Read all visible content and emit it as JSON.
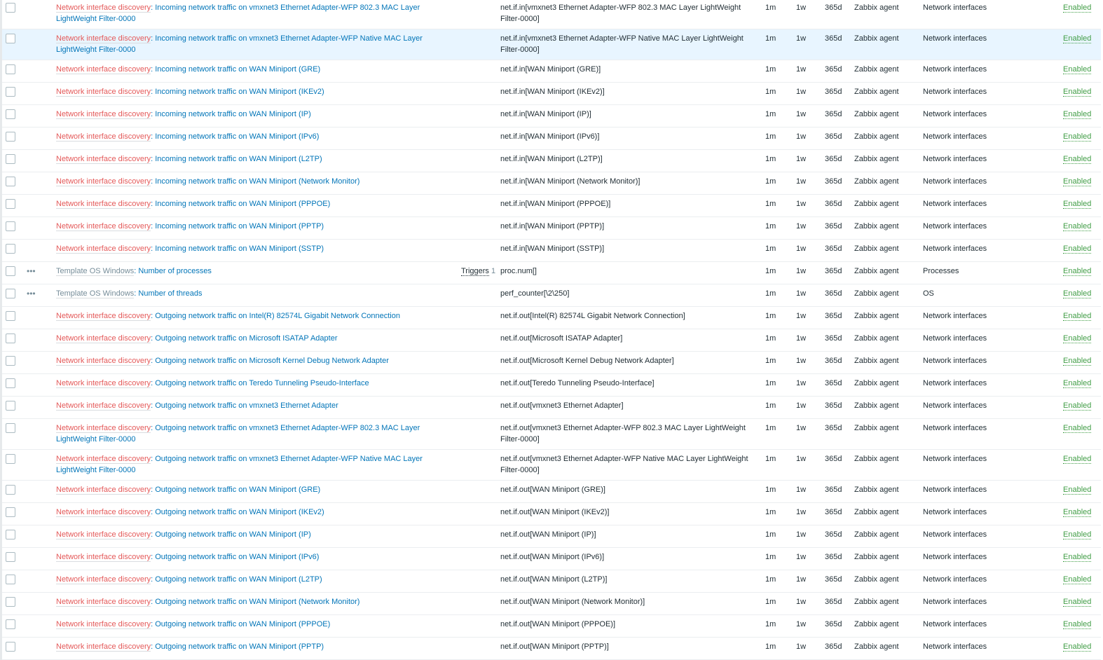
{
  "row_common": {
    "interval": "1m",
    "history": "1w",
    "trends": "365d",
    "type": "Zabbix agent",
    "status": "Enabled",
    "triggers_label": "Triggers"
  },
  "colors": {
    "discovery": "#e45959",
    "link": "#0275b8",
    "enabled": "#429e47",
    "highlight": "#e8f5ff"
  },
  "rows": [
    {
      "prefix": "Network interface discovery",
      "name": "Incoming network traffic on vmxnet3 Ethernet Adapter-WFP 802.3 MAC Layer LightWeight Filter-0000",
      "key": "net.if.in[vmxnet3 Ethernet Adapter-WFP 802.3 MAC Layer LightWeight Filter-0000]",
      "app": "Network interfaces"
    },
    {
      "prefix": "Network interface discovery",
      "name": "Incoming network traffic on vmxnet3 Ethernet Adapter-WFP Native MAC Layer LightWeight Filter-0000",
      "key": "net.if.in[vmxnet3 Ethernet Adapter-WFP Native MAC Layer LightWeight Filter-0000]",
      "app": "Network interfaces",
      "highlight": true
    },
    {
      "prefix": "Network interface discovery",
      "name": "Incoming network traffic on WAN Miniport (GRE)",
      "key": "net.if.in[WAN Miniport (GRE)]",
      "app": "Network interfaces"
    },
    {
      "prefix": "Network interface discovery",
      "name": "Incoming network traffic on WAN Miniport (IKEv2)",
      "key": "net.if.in[WAN Miniport (IKEv2)]",
      "app": "Network interfaces"
    },
    {
      "prefix": "Network interface discovery",
      "name": "Incoming network traffic on WAN Miniport (IP)",
      "key": "net.if.in[WAN Miniport (IP)]",
      "app": "Network interfaces"
    },
    {
      "prefix": "Network interface discovery",
      "name": "Incoming network traffic on WAN Miniport (IPv6)",
      "key": "net.if.in[WAN Miniport (IPv6)]",
      "app": "Network interfaces"
    },
    {
      "prefix": "Network interface discovery",
      "name": "Incoming network traffic on WAN Miniport (L2TP)",
      "key": "net.if.in[WAN Miniport (L2TP)]",
      "app": "Network interfaces"
    },
    {
      "prefix": "Network interface discovery",
      "name": "Incoming network traffic on WAN Miniport (Network Monitor)",
      "key": "net.if.in[WAN Miniport (Network Monitor)]",
      "app": "Network interfaces"
    },
    {
      "prefix": "Network interface discovery",
      "name": "Incoming network traffic on WAN Miniport (PPPOE)",
      "key": "net.if.in[WAN Miniport (PPPOE)]",
      "app": "Network interfaces"
    },
    {
      "prefix": "Network interface discovery",
      "name": "Incoming network traffic on WAN Miniport (PPTP)",
      "key": "net.if.in[WAN Miniport (PPTP)]",
      "app": "Network interfaces"
    },
    {
      "prefix": "Network interface discovery",
      "name": "Incoming network traffic on WAN Miniport (SSTP)",
      "key": "net.if.in[WAN Miniport (SSTP)]",
      "app": "Network interfaces"
    },
    {
      "prefix": "Template OS Windows",
      "template": true,
      "name": "Number of processes",
      "triggers": "1",
      "key": "proc.num[]",
      "app": "Processes"
    },
    {
      "prefix": "Template OS Windows",
      "template": true,
      "name": "Number of threads",
      "key": "perf_counter[\\2\\250]",
      "app": "OS"
    },
    {
      "prefix": "Network interface discovery",
      "name": "Outgoing network traffic on Intel(R) 82574L Gigabit Network Connection",
      "key": "net.if.out[Intel(R) 82574L Gigabit Network Connection]",
      "app": "Network interfaces"
    },
    {
      "prefix": "Network interface discovery",
      "name": "Outgoing network traffic on Microsoft ISATAP Adapter",
      "key": "net.if.out[Microsoft ISATAP Adapter]",
      "app": "Network interfaces"
    },
    {
      "prefix": "Network interface discovery",
      "name": "Outgoing network traffic on Microsoft Kernel Debug Network Adapter",
      "key": "net.if.out[Microsoft Kernel Debug Network Adapter]",
      "app": "Network interfaces"
    },
    {
      "prefix": "Network interface discovery",
      "name": "Outgoing network traffic on Teredo Tunneling Pseudo-Interface",
      "key": "net.if.out[Teredo Tunneling Pseudo-Interface]",
      "app": "Network interfaces"
    },
    {
      "prefix": "Network interface discovery",
      "name": "Outgoing network traffic on vmxnet3 Ethernet Adapter",
      "key": "net.if.out[vmxnet3 Ethernet Adapter]",
      "app": "Network interfaces"
    },
    {
      "prefix": "Network interface discovery",
      "name": "Outgoing network traffic on vmxnet3 Ethernet Adapter-WFP 802.3 MAC Layer LightWeight Filter-0000",
      "key": "net.if.out[vmxnet3 Ethernet Adapter-WFP 802.3 MAC Layer LightWeight Filter-0000]",
      "app": "Network interfaces"
    },
    {
      "prefix": "Network interface discovery",
      "name": "Outgoing network traffic on vmxnet3 Ethernet Adapter-WFP Native MAC Layer LightWeight Filter-0000",
      "key": "net.if.out[vmxnet3 Ethernet Adapter-WFP Native MAC Layer LightWeight Filter-0000]",
      "app": "Network interfaces"
    },
    {
      "prefix": "Network interface discovery",
      "name": "Outgoing network traffic on WAN Miniport (GRE)",
      "key": "net.if.out[WAN Miniport (GRE)]",
      "app": "Network interfaces"
    },
    {
      "prefix": "Network interface discovery",
      "name": "Outgoing network traffic on WAN Miniport (IKEv2)",
      "key": "net.if.out[WAN Miniport (IKEv2)]",
      "app": "Network interfaces"
    },
    {
      "prefix": "Network interface discovery",
      "name": "Outgoing network traffic on WAN Miniport (IP)",
      "key": "net.if.out[WAN Miniport (IP)]",
      "app": "Network interfaces"
    },
    {
      "prefix": "Network interface discovery",
      "name": "Outgoing network traffic on WAN Miniport (IPv6)",
      "key": "net.if.out[WAN Miniport (IPv6)]",
      "app": "Network interfaces"
    },
    {
      "prefix": "Network interface discovery",
      "name": "Outgoing network traffic on WAN Miniport (L2TP)",
      "key": "net.if.out[WAN Miniport (L2TP)]",
      "app": "Network interfaces"
    },
    {
      "prefix": "Network interface discovery",
      "name": "Outgoing network traffic on WAN Miniport (Network Monitor)",
      "key": "net.if.out[WAN Miniport (Network Monitor)]",
      "app": "Network interfaces"
    },
    {
      "prefix": "Network interface discovery",
      "name": "Outgoing network traffic on WAN Miniport (PPPOE)",
      "key": "net.if.out[WAN Miniport (PPPOE)]",
      "app": "Network interfaces"
    },
    {
      "prefix": "Network interface discovery",
      "name": "Outgoing network traffic on WAN Miniport (PPTP)",
      "key": "net.if.out[WAN Miniport (PPTP)]",
      "app": "Network interfaces"
    }
  ]
}
